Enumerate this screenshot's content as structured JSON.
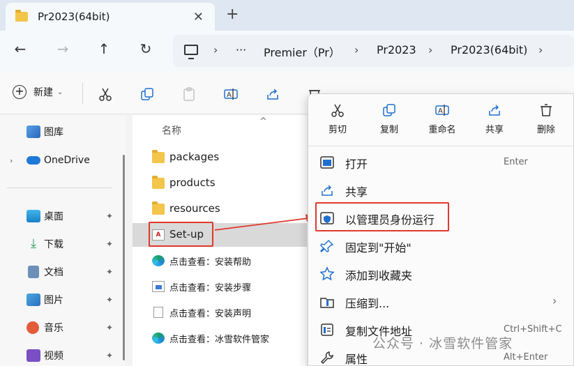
{
  "window": {
    "tab_title": "Pr2023(64bit)",
    "close_glyph": "✕",
    "newtab_glyph": "+"
  },
  "nav": {
    "back": "←",
    "forward": "→",
    "up": "↑",
    "refresh": "↻"
  },
  "breadcrumb": {
    "more": "···",
    "sep": "›",
    "items": [
      "Premier（Pr）",
      "Pr2023",
      "Pr2023(64bit)"
    ]
  },
  "toolbar": {
    "new_label": "新建",
    "new_caret": "⌄"
  },
  "sidebar": {
    "items": [
      {
        "label": "图库",
        "icon": "gallery-icon"
      },
      {
        "label": "OneDrive",
        "icon": "onedrive-icon"
      },
      {
        "label": "桌面",
        "icon": "desktop-icon"
      },
      {
        "label": "下载",
        "icon": "download-icon"
      },
      {
        "label": "文档",
        "icon": "documents-icon"
      },
      {
        "label": "图片",
        "icon": "pictures-icon"
      },
      {
        "label": "音乐",
        "icon": "music-icon"
      },
      {
        "label": "视频",
        "icon": "videos-icon"
      }
    ],
    "expander": "›",
    "pin_glyph": "📌"
  },
  "filelist": {
    "column_name": "名称",
    "sort_caret": "^",
    "rows": [
      {
        "name": "packages",
        "type": "folder"
      },
      {
        "name": "products",
        "type": "folder"
      },
      {
        "name": "resources",
        "type": "folder"
      },
      {
        "name": "Set-up",
        "type": "exe"
      },
      {
        "name": "点击查看：安装帮助",
        "type": "edge-link"
      },
      {
        "name": "点击查看：安装步骤",
        "type": "image"
      },
      {
        "name": "点击查看：安装声明",
        "type": "text"
      },
      {
        "name": "点击查看：冰雪软件管家",
        "type": "edge-link"
      }
    ]
  },
  "context_menu": {
    "quick_actions": [
      "剪切",
      "复制",
      "重命名",
      "共享",
      "删除"
    ],
    "items": [
      {
        "label": "打开",
        "accel": "Enter",
        "icon": "open-icon"
      },
      {
        "label": "共享",
        "accel": "",
        "icon": "share-icon"
      },
      {
        "label": "以管理员身份运行",
        "accel": "",
        "icon": "admin-shield-icon"
      },
      {
        "label": "固定到\"开始\"",
        "accel": "",
        "icon": "pin-icon"
      },
      {
        "label": "添加到收藏夹",
        "accel": "",
        "icon": "star-icon"
      },
      {
        "label": "压缩到...",
        "accel": "",
        "icon": "zip-icon",
        "submenu": "›"
      },
      {
        "label": "复制文件地址",
        "accel": "Ctrl+Shift+C",
        "icon": "copy-path-icon"
      },
      {
        "label": "属性",
        "accel": "Alt+Enter",
        "icon": "properties-icon"
      }
    ]
  },
  "watermark": "公众号 · 冰雪软件管家",
  "colors": {
    "highlight_red": "#e0382d",
    "accent_blue": "#1f6fd0",
    "folder_yellow": "#f3c54a"
  }
}
